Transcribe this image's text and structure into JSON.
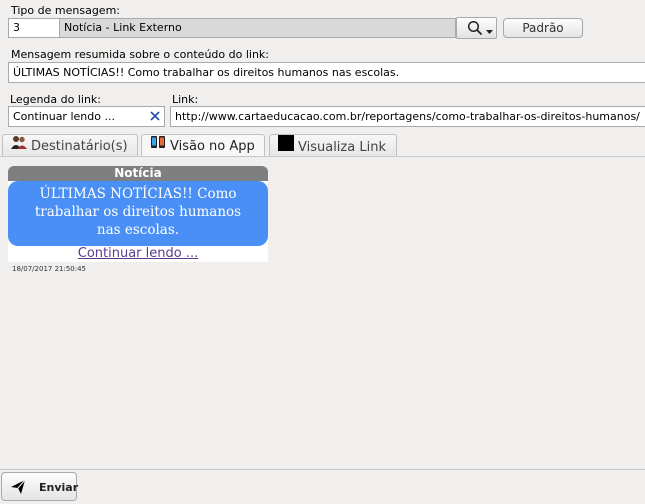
{
  "form": {
    "tipo_label": "Tipo de mensagem:",
    "tipo_code": "3",
    "tipo_name": "Notícia - Link Externo",
    "padrao_button": "Padrão",
    "resumo_label": "Mensagem resumida sobre o conteúdo do link:",
    "resumo_value": "ÚLTIMAS NOTÍCIAS!! Como trabalhar os direitos humanos nas escolas.",
    "legenda_label": "Legenda do link:",
    "legenda_value": "Continuar lendo ...",
    "link_label": "Link:",
    "link_value": "http://www.cartaeducacao.com.br/reportagens/como-trabalhar-os-direitos-humanos/"
  },
  "tabs": [
    {
      "label": "Destinatário(s)",
      "icon": "users-icon"
    },
    {
      "label": "Visão no App",
      "icon": "phone-icon",
      "active": true
    },
    {
      "label": "Visualiza Link",
      "icon": "black-square-icon"
    }
  ],
  "preview": {
    "header": "Notícia",
    "bubble_text": "ÚLTIMAS NOTÍCIAS!! Como trabalhar os direitos humanos nas escolas.",
    "link_text": "Continuar lendo ...",
    "timestamp": "18/07/2017 21:50:45"
  },
  "footer": {
    "send_button": "Enviar"
  },
  "colors": {
    "bubble": "#4a8ff5",
    "preview_header": "#7f7f7f",
    "link": "#5b3b8c"
  }
}
